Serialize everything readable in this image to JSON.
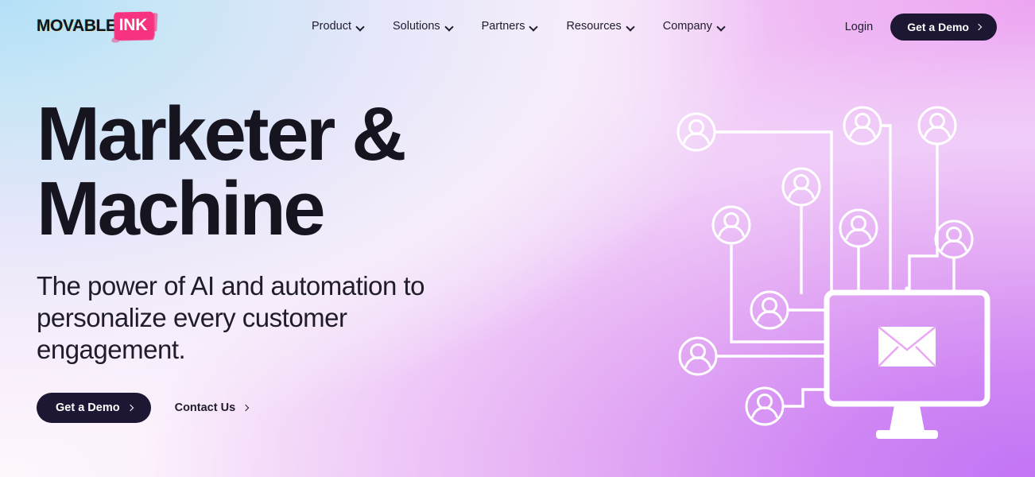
{
  "header": {
    "logo": {
      "word_dark": "MOVABLE",
      "word_highlight": "INK",
      "highlight_color": "#f7337f",
      "name": "Movable Ink"
    },
    "nav_items": [
      {
        "label": "Product",
        "icon": "chevron-down-icon",
        "has_dropdown": true
      },
      {
        "label": "Solutions",
        "icon": "chevron-down-icon",
        "has_dropdown": true
      },
      {
        "label": "Partners",
        "icon": "chevron-down-icon",
        "has_dropdown": true
      },
      {
        "label": "Resources",
        "icon": "chevron-down-icon",
        "has_dropdown": true
      },
      {
        "label": "Company",
        "icon": "chevron-down-icon",
        "has_dropdown": true
      }
    ],
    "login_label": "Login",
    "demo_button": {
      "label": "Get a Demo",
      "icon": "chevron-right-icon",
      "background": "#1d1733",
      "text_color": "#ffffff"
    }
  },
  "hero": {
    "title": "Marketer &\nMachine",
    "title_color": "#16141f",
    "subtitle": "The power of AI and automation to personalize every customer engagement.",
    "primary_cta": {
      "label": "Get a Demo",
      "icon": "chevron-right-icon",
      "background": "#1d1733",
      "text_color": "#ffffff"
    },
    "secondary_cta": {
      "label": "Contact Us",
      "icon": "chevron-right-icon",
      "text_color": "#1f1c2c"
    }
  },
  "illustration": {
    "name": "network-of-users-to-email-monitor",
    "description": "Ten outlined user avatar nodes connected by white circuit lines to a computer monitor displaying an envelope icon",
    "stroke_color": "#ffffff",
    "avatar_count": 10,
    "device_icon": "monitor-icon",
    "screen_icon": "envelope-icon"
  },
  "background": {
    "top_left": "#b4e0f7",
    "top_right": "#eda6f2",
    "bottom_left": "#fdf6fd",
    "bottom_right": "#c274f5",
    "center": "#f3e2fb"
  }
}
